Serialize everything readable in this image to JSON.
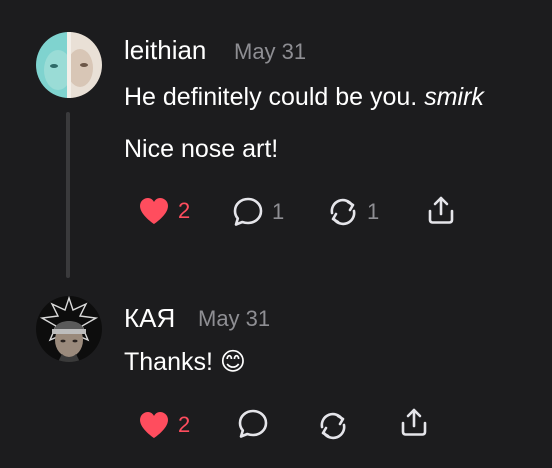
{
  "colors": {
    "background": "#1c1c1e",
    "text_primary": "#ffffff",
    "text_secondary": "#8e8e93",
    "like_active": "#ff4d5e",
    "thread_line": "#3a3a3c"
  },
  "replies": [
    {
      "author": "leithian",
      "date": "May 31",
      "lines": [
        {
          "text": "He definitely could be you. ",
          "emphasis": "smirk"
        },
        {
          "text": "Nice nose art!"
        }
      ],
      "actions": {
        "like": {
          "icon": "heart-icon",
          "count": "2",
          "liked": true
        },
        "comment": {
          "icon": "speech-bubble-icon",
          "count": "1"
        },
        "repost": {
          "icon": "repost-icon",
          "count": "1"
        },
        "share": {
          "icon": "share-icon"
        }
      }
    },
    {
      "author": "КАЯ",
      "date": "May 31",
      "lines": [
        {
          "text": "Thanks!",
          "emoji": "😊"
        }
      ],
      "actions": {
        "like": {
          "icon": "heart-icon",
          "count": "2",
          "liked": true
        },
        "comment": {
          "icon": "speech-bubble-icon",
          "count": ""
        },
        "repost": {
          "icon": "repost-icon",
          "count": ""
        },
        "share": {
          "icon": "share-icon"
        }
      }
    }
  ]
}
